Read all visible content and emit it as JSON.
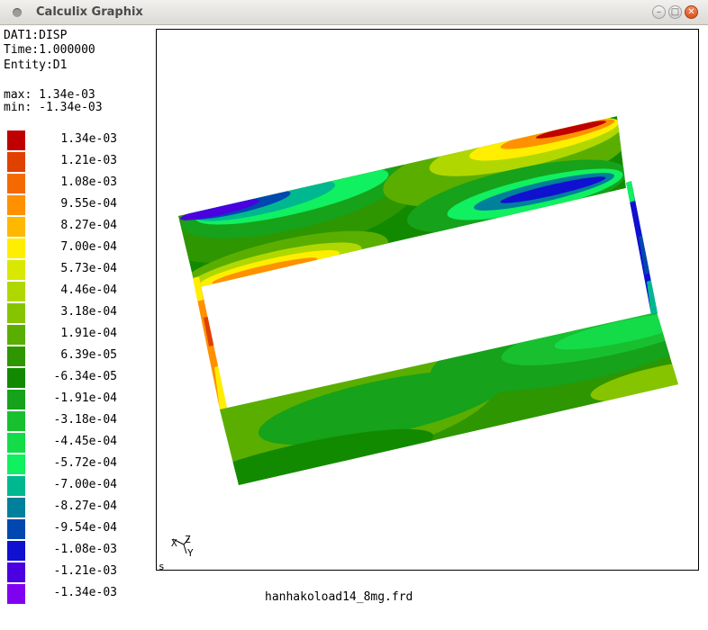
{
  "window": {
    "title": "Calculix Graphix",
    "buttons": [
      "–",
      "□",
      "✕"
    ]
  },
  "dataset": {
    "line1": "DAT1:DISP",
    "line2": "Time:1.000000",
    "line3": "Entity:D1",
    "max": "max: 1.34e-03",
    "min": "min: -1.34e-03"
  },
  "legend": [
    {
      "label": "1.34e-03",
      "color": "#c00000"
    },
    {
      "label": "1.21e-03",
      "color": "#e04000"
    },
    {
      "label": "1.08e-03",
      "color": "#f46a00"
    },
    {
      "label": "9.55e-04",
      "color": "#ff9000"
    },
    {
      "label": "8.27e-04",
      "color": "#ffb800"
    },
    {
      "label": "7.00e-04",
      "color": "#ffee00"
    },
    {
      "label": "5.73e-04",
      "color": "#d8e800"
    },
    {
      "label": "4.46e-04",
      "color": "#b0d800"
    },
    {
      "label": "3.18e-04",
      "color": "#86c400"
    },
    {
      "label": "1.91e-04",
      "color": "#5aae00"
    },
    {
      "label": "6.39e-05",
      "color": "#2e9600"
    },
    {
      "label": "-6.34e-05",
      "color": "#128a00"
    },
    {
      "label": "-1.91e-04",
      "color": "#16a21a"
    },
    {
      "label": "-3.18e-04",
      "color": "#18c030"
    },
    {
      "label": "-4.45e-04",
      "color": "#14dc48"
    },
    {
      "label": "-5.72e-04",
      "color": "#10f060"
    },
    {
      "label": "-7.00e-04",
      "color": "#00b890"
    },
    {
      "label": "-8.27e-04",
      "color": "#00809a"
    },
    {
      "label": "-9.54e-04",
      "color": "#0048b0"
    },
    {
      "label": "-1.08e-03",
      "color": "#1010d0"
    },
    {
      "label": "-1.21e-03",
      "color": "#4a00e0"
    },
    {
      "label": "-1.34e-03",
      "color": "#8000f0"
    }
  ],
  "viewport": {
    "axis_x": "X",
    "axis_y": "Y",
    "axis_z": "Z",
    "corner_label": "s"
  },
  "filename": "hanhakoload14_8mg.frd"
}
